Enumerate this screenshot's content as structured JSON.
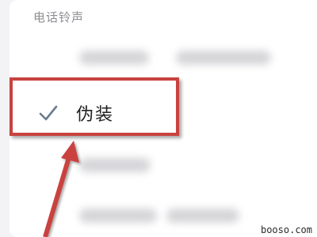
{
  "section": {
    "title": "电话铃声"
  },
  "options": [
    {
      "label": "伪装",
      "checked": true
    }
  ],
  "colors": {
    "highlight": "#c9423f",
    "check": "#6b7b8f"
  },
  "watermark": "booso.com"
}
